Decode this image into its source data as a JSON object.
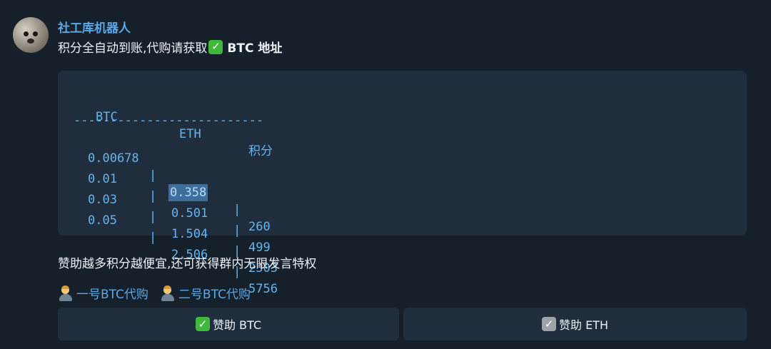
{
  "sender": {
    "name": "社工库机器人"
  },
  "message": {
    "intro": "积分全自动到账,代购请获取",
    "intro_suffix": "BTC 地址",
    "check_glyph": "✓"
  },
  "table": {
    "headers": [
      "BTC",
      "ETH",
      "积分"
    ],
    "separator": "--------------------------",
    "rows": [
      [
        "0.00678",
        "0.358",
        "260"
      ],
      [
        "0.01",
        "0.501",
        "499"
      ],
      [
        "0.03",
        "1.504",
        "2303"
      ],
      [
        "0.05",
        "2.506",
        "5756"
      ]
    ],
    "divider": "|",
    "highlighted_cell": "0.358"
  },
  "promo_text": "赞助越多积分越便宜,还可获得群内无限发言特权",
  "links": [
    {
      "label": "一号BTC代购",
      "icon": "person-icon"
    },
    {
      "label": "二号BTC代购",
      "icon": "person-icon"
    }
  ],
  "buttons": {
    "btc": "赞助 BTC",
    "eth": "赞助 ETH"
  },
  "colors": {
    "background": "#16202b",
    "bubble": "#1f2d3c",
    "accent": "#5aa8e6",
    "code_text": "#64b5f0",
    "check_green": "#3fb93b"
  }
}
